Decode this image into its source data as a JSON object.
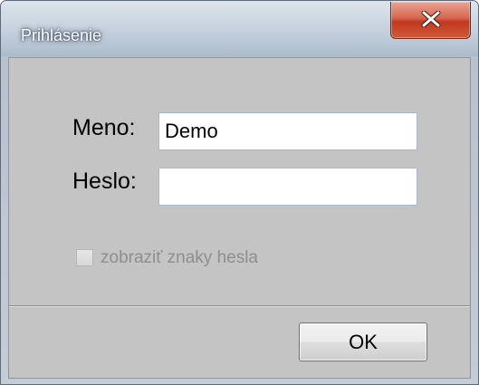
{
  "window": {
    "title": "Prihlásenie"
  },
  "titlebar": {
    "close_icon": "close-x-icon",
    "close_color": "#c2381f"
  },
  "form": {
    "username_label": "Meno:",
    "username_value": "Demo",
    "password_label": "Heslo:",
    "password_value": "",
    "show_password_label": "zobraziť znaky hesla",
    "show_password_checked": false,
    "show_password_enabled": false
  },
  "footer": {
    "ok_label": "OK"
  }
}
